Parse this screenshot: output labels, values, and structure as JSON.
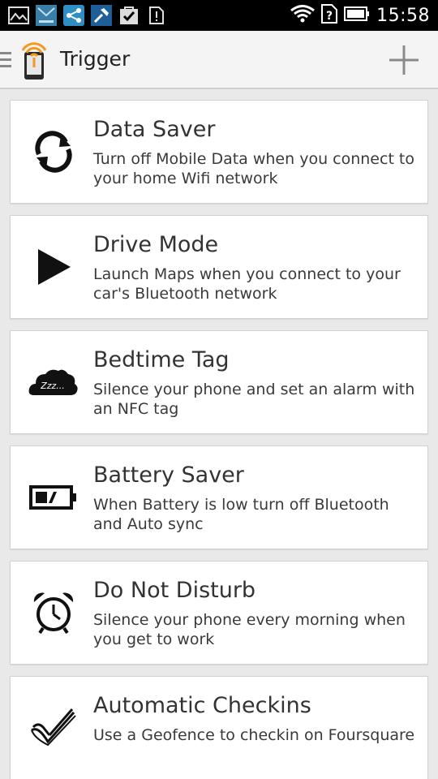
{
  "status_bar": {
    "time": "15:58",
    "left_icons": [
      "gallery-icon",
      "app-icon",
      "share-icon",
      "pin-icon",
      "check-bag-icon",
      "alert-icon"
    ],
    "right_icons": [
      "wifi-icon",
      "no-sim-icon",
      "battery-icon"
    ]
  },
  "action_bar": {
    "title": "Trigger",
    "add_icon": "plus-icon"
  },
  "tasks": [
    {
      "title": "Data Saver",
      "description": "Turn off Mobile Data when you connect to your home Wifi network",
      "icon": "sync-icon"
    },
    {
      "title": "Drive Mode",
      "description": "Launch Maps when you connect to your car's Bluetooth network",
      "icon": "play-icon"
    },
    {
      "title": "Bedtime Tag",
      "description": "Silence your phone and set an alarm with an NFC tag",
      "icon": "sleep-cloud-icon",
      "icon_text": "Zzz..."
    },
    {
      "title": "Battery Saver",
      "description": "When Battery is low turn off Bluetooth and Auto sync",
      "icon": "battery-low-icon"
    },
    {
      "title": "Do Not Disturb",
      "description": "Silence your phone every morning when you get to work",
      "icon": "alarm-clock-icon"
    },
    {
      "title": "Automatic Checkins",
      "description": "Use a Geofence to checkin on Foursquare",
      "icon": "checkin-icon"
    }
  ]
}
